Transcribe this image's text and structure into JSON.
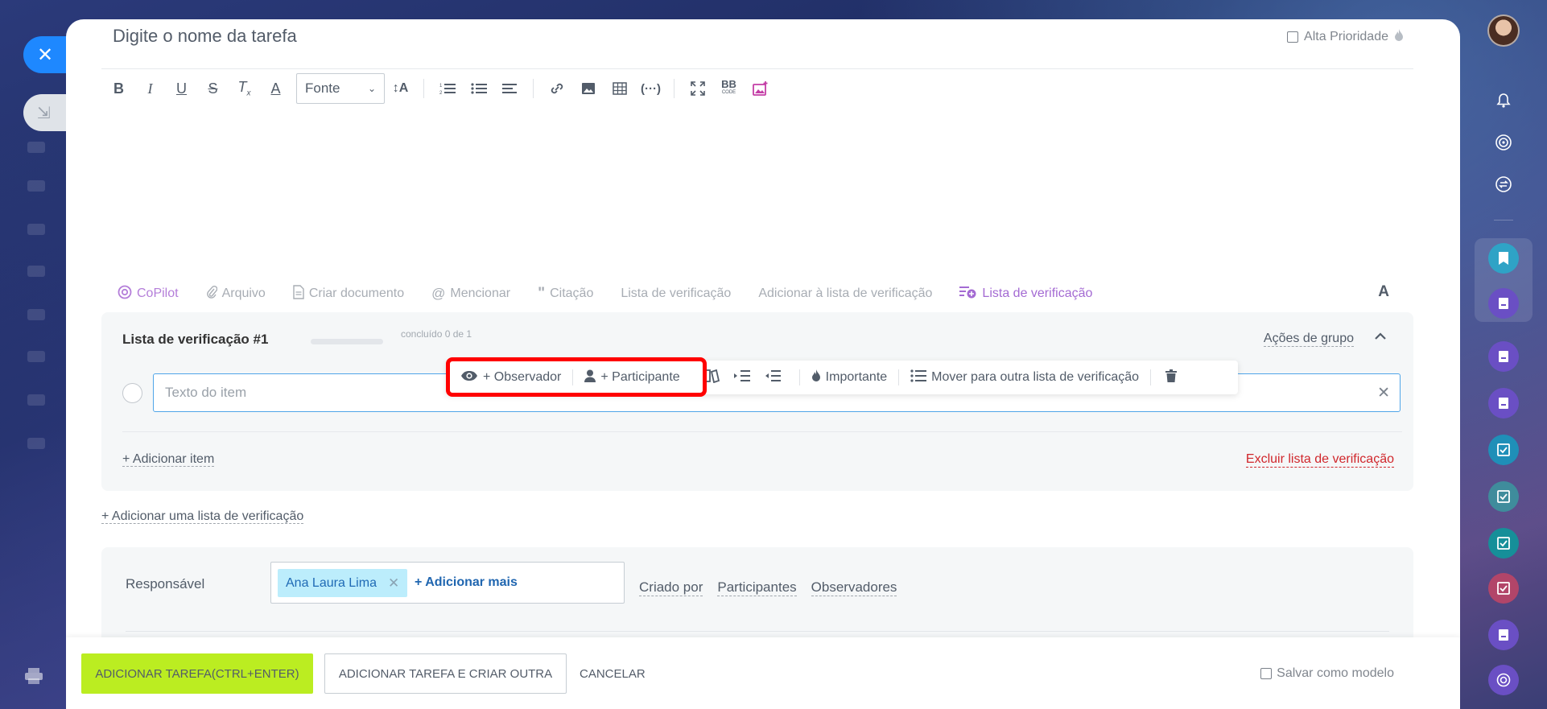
{
  "task": {
    "title_placeholder": "Digite o nome da tarefa",
    "high_priority_label": "Alta Prioridade"
  },
  "editor_toolbar": {
    "font_select_value": "Fonte",
    "bbcode_label": "BB",
    "bbcode_sub": "CODE"
  },
  "attach_bar": {
    "copilot": "CoPilot",
    "file": "Arquivo",
    "create_document": "Criar documento",
    "mention": "Mencionar",
    "quote": "Citação",
    "checklist": "Lista de verificação",
    "add_to_checklist": "Adicionar à lista de verificação",
    "checklist_active": "Lista de verificação",
    "text_format": "A"
  },
  "checklist": {
    "title": "Lista de verificação #1",
    "progress_text": "concluído 0 de 1",
    "progress": 0,
    "group_actions": "Ações de grupo",
    "item_placeholder": "Texto do item",
    "add_item": "+ Adicionar item",
    "delete_list": "Excluir lista de verificação"
  },
  "item_toolbar": {
    "observer": "+ Observador",
    "participant": "+ Participante",
    "important": "Importante",
    "move": "Mover para outra lista de verificação"
  },
  "add_checklist": "+ Adicionar uma lista de verificação",
  "responsible": {
    "label": "Responsável",
    "assignee": "Ana Laura Lima",
    "add_more": "+ Adicionar mais",
    "links": [
      "Criado por",
      "Participantes",
      "Observadores"
    ]
  },
  "footer": {
    "primary": "ADICIONAR TAREFA(CTRL+ENTER)",
    "secondary": "ADICIONAR TAREFA E CRIAR OUTRA",
    "cancel": "CANCELAR",
    "save_template": "Salvar como modelo"
  },
  "colors": {
    "accent_green": "#bbed21",
    "link_blue": "#2066b0",
    "danger_red": "#d0262b",
    "highlight": "#ff0000"
  },
  "icons": [
    "close-icon",
    "minimize-icon",
    "print-icon",
    "bell-icon",
    "target-icon",
    "sync-icon",
    "bookmark-icon",
    "task-icon",
    "checkbox-icon",
    "eye-icon",
    "user-icon",
    "trash-icon",
    "flame-icon",
    "list-icon"
  ]
}
